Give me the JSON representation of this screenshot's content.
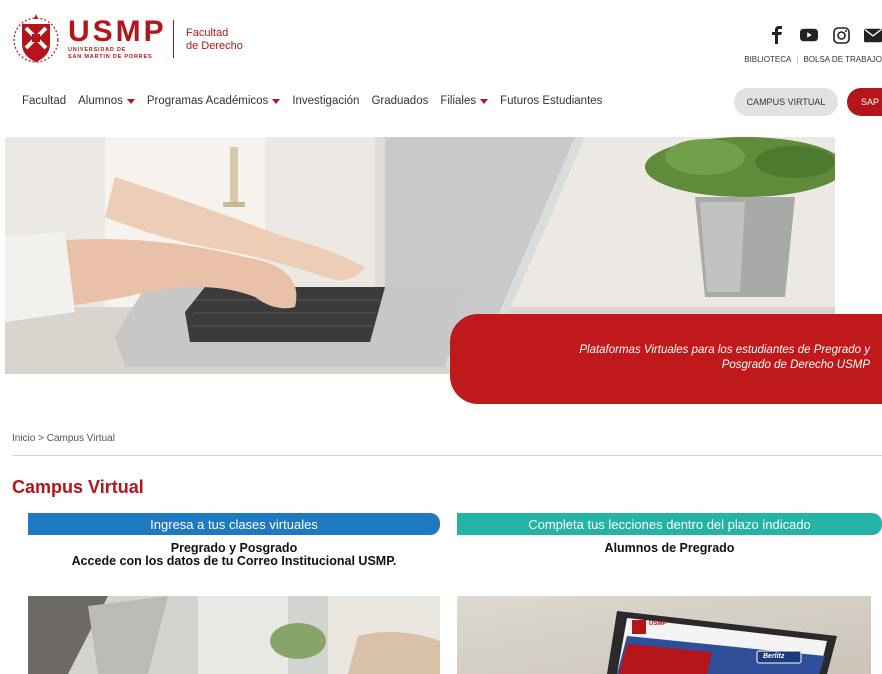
{
  "header": {
    "brand": "USMP",
    "brand_sub1": "UNIVERSIDAD DE",
    "brand_sub2": "SAN MARTIN DE PORRES",
    "faculty_line1": "Facultad",
    "faculty_line2": "de Derecho",
    "social_icons": [
      "facebook-icon",
      "youtube-icon",
      "instagram-icon",
      "mail-icon"
    ],
    "top_links": [
      "BIBLIOTECA",
      "BOLSA DE TRABAJO"
    ]
  },
  "nav": {
    "items": [
      {
        "label": "Facultad",
        "dropdown": false
      },
      {
        "label": "Alumnos",
        "dropdown": true
      },
      {
        "label": "Programas Académicos",
        "dropdown": true
      },
      {
        "label": "Investigación",
        "dropdown": false
      },
      {
        "label": "Graduados",
        "dropdown": false
      },
      {
        "label": "Filiales",
        "dropdown": true
      },
      {
        "label": "Futuros Estudiantes",
        "dropdown": false
      }
    ],
    "campus_button": "CAMPUS VIRTUAL",
    "sap_button": "SAP"
  },
  "hero": {
    "caption_line1": "Plataformas Virtuales para los estudiantes de Pregrado y",
    "caption_line2": "Posgrado de Derecho USMP"
  },
  "breadcrumb": "Inicio > Campus Virtual",
  "section_title": "Campus Virtual",
  "cards": {
    "left": {
      "band": "Ingresa a tus clases virtuales",
      "line1": "Pregrado y Posgrado",
      "line2": "Accede con los datos de tu Correo Institucional USMP."
    },
    "right": {
      "band": "Completa tus lecciones dentro del plazo indicado",
      "line1": "Alumnos de Pregrado",
      "screen_brand": "USMP",
      "screen_badge": "Berlitz"
    }
  },
  "colors": {
    "brand_red": "#b4151a",
    "band_blue": "#1e79c0",
    "band_teal": "#23b4a5"
  }
}
